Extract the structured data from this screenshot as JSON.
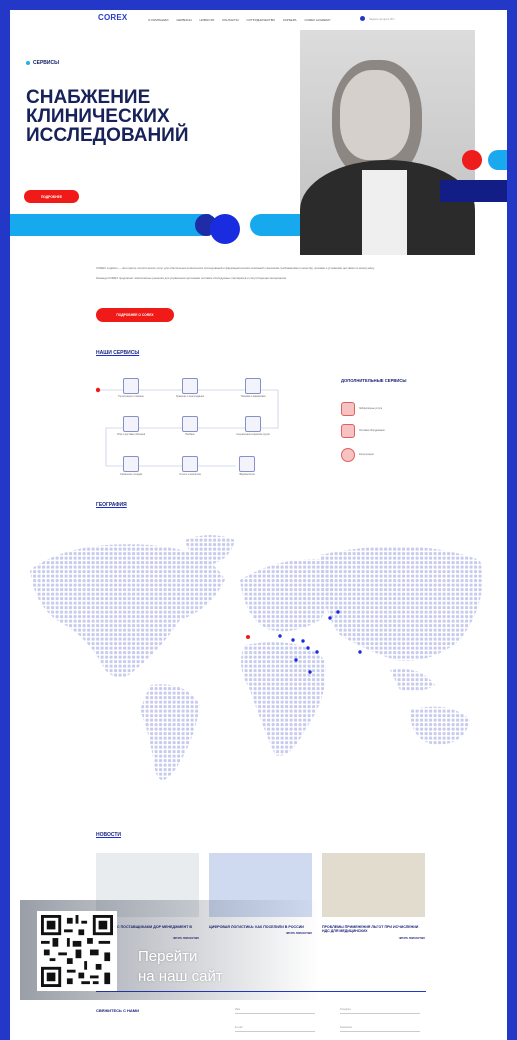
{
  "nav": {
    "logo": "COREX",
    "items": [
      "О КОМПАНИИ",
      "СЕРВИСЫ",
      "НОВОСТИ",
      "КОНТАКТЫ",
      "СОТРУДНИЧЕСТВО",
      "КАРЬЕРА",
      "COREX ACADEMY"
    ],
    "right_text": "Задать вопрос  RU"
  },
  "hero": {
    "tag": "СЕРВИСЫ",
    "title": "СНАБЖЕНИЕ КЛИНИЧЕСКИХ ИССЛЕДОВАНИЙ",
    "button": "ПОДРОБНЕЕ"
  },
  "intro": {
    "p1": "COREX Logistics — интегратор логистических услуг для обеспечения клинических исследований и фармацевтических компаний с высокими требованиями к качеству, сроками и условиями доставки по всему миру.",
    "p2": "Команда COREX предлагает комплексные решения для управления цепочками поставок исследуемых препаратов и сопутствующих материалов.",
    "button": "ПОДРОБНЕЕ О COREX"
  },
  "services": {
    "title": "НАШИ СЕРВИСЫ",
    "items": [
      "Регистрация и таможня",
      "Хранение и консолидация",
      "Упаковка и маркировка",
      "Сбор и доставка образцов",
      "Биобанк",
      "Специальная перевозка грузов",
      "Управление складом",
      "Отчеты и аналитика",
      "Фармакология"
    ],
    "additional_title": "ДОПОЛНИТЕЛЬНЫЕ СЕРВИСЫ",
    "additional_items": [
      "Лабораторные услуги",
      "Поставка оборудования",
      "Консультации"
    ]
  },
  "geography": {
    "title": "ГЕОГРАФИЯ"
  },
  "news": {
    "title": "НОВОСТИ",
    "items": [
      {
        "date": "",
        "title": "РАБОТАЕМ С ПОСТАВЩИКАМИ ДОР МЕНЕДЖМЕНТ В COREX",
        "text": "",
        "more": "ЧИТАТЬ ПОЛНОСТЬЮ"
      },
      {
        "date": "",
        "title": "ЦИФРОВАЯ ЛОГИСТИКА: КАК ПОСЕЛИЛИ В РОССИИ",
        "text": "",
        "more": "ЧИТАТЬ ПОЛНОСТЬЮ"
      },
      {
        "date": "",
        "title": "ПРОБЛЕМЫ ПРИМЕНЕНИЯ ЛЬГОТ ПРИ ИСЧИСЛЕНИИ НДС ДЛЯ МЕДИЦИНСКИХ",
        "text": "",
        "more": "ЧИТАТЬ ПОЛНОСТЬЮ"
      }
    ]
  },
  "contact": {
    "title": "СВЯЖИТЕСЬ С НАМИ",
    "text": "",
    "fields": [
      "Имя",
      "Телефон",
      "E-mail",
      "Компания"
    ]
  },
  "overlay": {
    "cta_line1": "Перейти",
    "cta_line2": "на наш сайт"
  },
  "colors": {
    "brand_blue": "#2438c8",
    "red": "#f01b18",
    "cyan": "#17a9ee",
    "navy": "#17215a"
  }
}
